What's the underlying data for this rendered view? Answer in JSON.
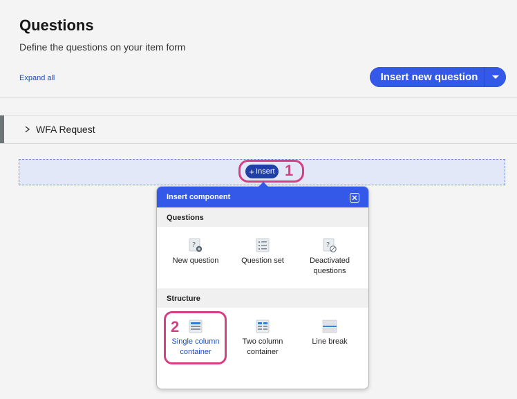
{
  "header": {
    "title": "Questions",
    "subtitle": "Define the questions on your item form",
    "expand_all": "Expand all",
    "insert_new_question": "Insert new question"
  },
  "section": {
    "label": "WFA Request"
  },
  "dropzone": {
    "insert_label": "Insert"
  },
  "callouts": {
    "one": "1",
    "two": "2"
  },
  "popup": {
    "title": "Insert component",
    "groups": [
      {
        "name": "Questions",
        "items": [
          {
            "label": "New question",
            "icon": "question-add-icon"
          },
          {
            "label": "Question set",
            "icon": "list-icon"
          },
          {
            "label": "Deactivated questions",
            "icon": "question-disabled-icon"
          }
        ]
      },
      {
        "name": "Structure",
        "items": [
          {
            "label": "Single column container",
            "icon": "single-column-icon",
            "selected": true
          },
          {
            "label": "Two column container",
            "icon": "two-column-icon"
          },
          {
            "label": "Line break",
            "icon": "line-break-icon"
          }
        ]
      }
    ]
  },
  "colors": {
    "accent": "#3458e8",
    "highlight": "#d63f82",
    "link": "#1b4fc4"
  }
}
